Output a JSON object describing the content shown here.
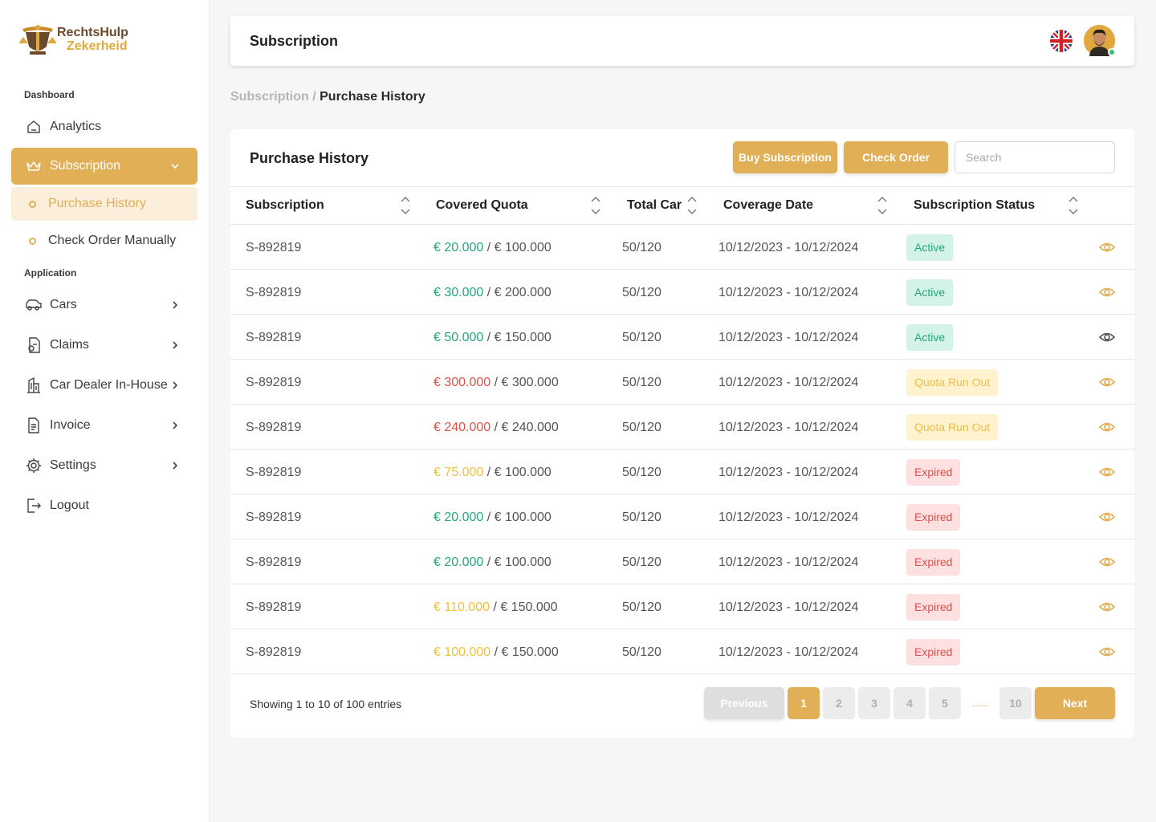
{
  "brand": {
    "line1": "RechtsHulp",
    "line2": "Zekerheid"
  },
  "sidebar": {
    "section_dashboard": "Dashboard",
    "section_application": "Application",
    "analytics": "Analytics",
    "subscription": "Subscription",
    "purchase_history": "Purchase History",
    "check_order_manually": "Check Order Manually",
    "cars": "Cars",
    "claims": "Claims",
    "car_dealer": "Car Dealer In-House",
    "invoice": "Invoice",
    "settings": "Settings",
    "logout": "Logout"
  },
  "header": {
    "title": "Subscription"
  },
  "breadcrumb": {
    "parent": "Subscription",
    "separator": " / ",
    "current": "Purchase History"
  },
  "card": {
    "title": "Purchase History",
    "buy_label": "Buy Subscription",
    "check_label": "Check Order",
    "search_placeholder": "Search"
  },
  "table": {
    "columns": [
      "Subscription",
      "Covered Quota",
      "Total Car",
      "Coverage Date",
      "Subscription Status"
    ],
    "rows": [
      {
        "id": "S-892819",
        "used": "€ 20.000",
        "used_color": "green",
        "sep": " / ",
        "total": "€ 100.000",
        "cars": "50/120",
        "date": "10/12/2023 - 10/12/2024",
        "status": "Active",
        "status_type": "active",
        "eye": "#e1af55"
      },
      {
        "id": "S-892819",
        "used": "€ 30.000",
        "used_color": "green",
        "sep": " / ",
        "total": "€ 200.000",
        "cars": "50/120",
        "date": "10/12/2023 - 10/12/2024",
        "status": "Active",
        "status_type": "active",
        "eye": "#e1af55"
      },
      {
        "id": "S-892819",
        "used": "€ 50.000",
        "used_color": "green",
        "sep": " / ",
        "total": "€ 150.000",
        "cars": "50/120",
        "date": "10/12/2023 - 10/12/2024",
        "status": "Active",
        "status_type": "active",
        "eye": "#555555"
      },
      {
        "id": "S-892819",
        "used": "€ 300.000",
        "used_color": "red",
        "sep": " / ",
        "total": "€ 300.000",
        "cars": "50/120",
        "date": "10/12/2023 - 10/12/2024",
        "status": "Quota Run Out",
        "status_type": "quota",
        "eye": "#e1af55"
      },
      {
        "id": "S-892819",
        "used": "€ 240.000",
        "used_color": "red",
        "sep": " / ",
        "total": "€ 240.000",
        "cars": "50/120",
        "date": "10/12/2023 - 10/12/2024",
        "status": "Quota Run Out",
        "status_type": "quota",
        "eye": "#e1af55"
      },
      {
        "id": "S-892819",
        "used": "€ 75.000",
        "used_color": "yellow",
        "sep": " / ",
        "total": "€ 100.000",
        "cars": "50/120",
        "date": "10/12/2023 - 10/12/2024",
        "status": "Expired",
        "status_type": "expired",
        "eye": "#e1af55"
      },
      {
        "id": "S-892819",
        "used": "€ 20.000",
        "used_color": "green",
        "sep": " / ",
        "total": "€ 100.000",
        "cars": "50/120",
        "date": "10/12/2023 - 10/12/2024",
        "status": "Expired",
        "status_type": "expired",
        "eye": "#e1af55"
      },
      {
        "id": "S-892819",
        "used": "€ 20.000",
        "used_color": "green",
        "sep": " / ",
        "total": "€ 100.000",
        "cars": "50/120",
        "date": "10/12/2023 - 10/12/2024",
        "status": "Expired",
        "status_type": "expired",
        "eye": "#e1af55"
      },
      {
        "id": "S-892819",
        "used": "€ 110.000",
        "used_color": "yellow",
        "sep": " / ",
        "total": "€ 150.000",
        "cars": "50/120",
        "date": "10/12/2023 - 10/12/2024",
        "status": "Expired",
        "status_type": "expired",
        "eye": "#e1af55"
      },
      {
        "id": "S-892819",
        "used": "€ 100.000",
        "used_color": "yellow",
        "sep": " / ",
        "total": "€ 150.000",
        "cars": "50/120",
        "date": "10/12/2023 - 10/12/2024",
        "status": "Expired",
        "status_type": "expired",
        "eye": "#e1af55"
      }
    ]
  },
  "pagination": {
    "summary": "Showing 1 to 10 of 100 entries",
    "previous": "Previous",
    "next": "Next",
    "pages": [
      "1",
      "2",
      "3",
      "4",
      "5"
    ],
    "ellipsis": "......",
    "last": "10",
    "current": "1"
  },
  "colors": {
    "accent": "#e1af55",
    "active": "#22a878",
    "quota": "#f3bd43",
    "expired": "#e0504b"
  }
}
